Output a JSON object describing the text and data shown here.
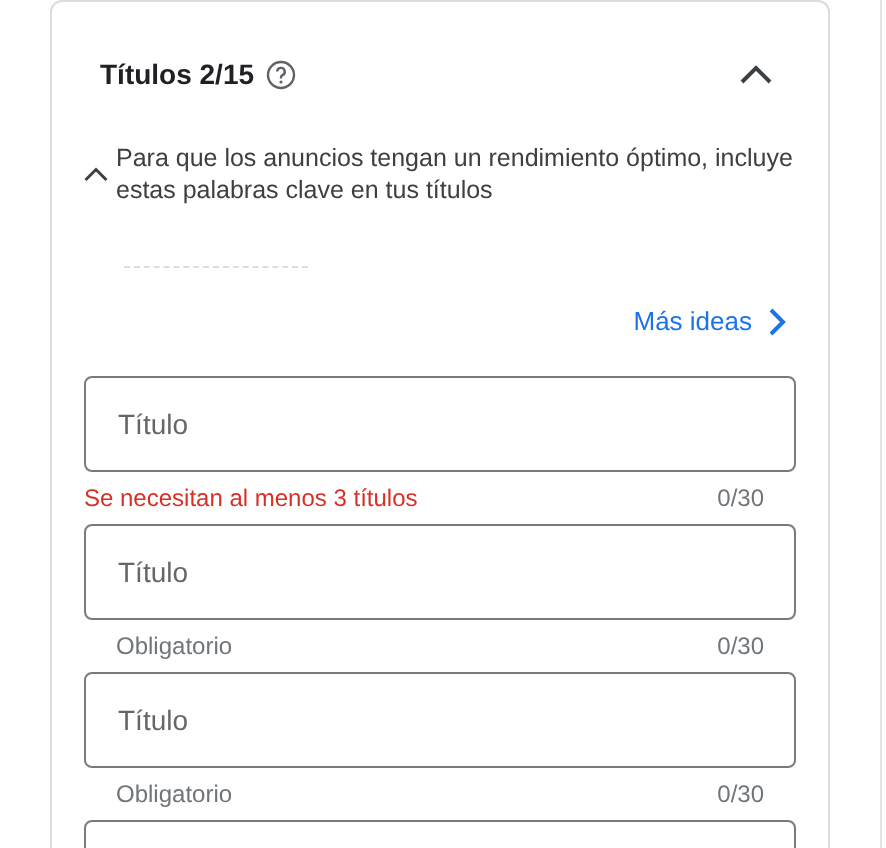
{
  "section": {
    "title": "Títulos 2/15",
    "expanded": true
  },
  "tip": {
    "text": "Para que los anuncios tengan un rendimiento óptimo, incluye estas palabras clave en tus títulos",
    "expanded": true
  },
  "more_link": "Más ideas",
  "fields": [
    {
      "kind": "field",
      "placeholder": "Título",
      "helper": "Se necesitan al menos 3 títulos",
      "error": true,
      "counter": "0/30"
    },
    {
      "kind": "field",
      "placeholder": "Título",
      "helper": "Obligatorio",
      "error": false,
      "counter": "0/30"
    },
    {
      "kind": "field",
      "placeholder": "Título",
      "helper": "Obligatorio",
      "error": false,
      "counter": "0/30"
    },
    {
      "kind": "field"
    }
  ]
}
